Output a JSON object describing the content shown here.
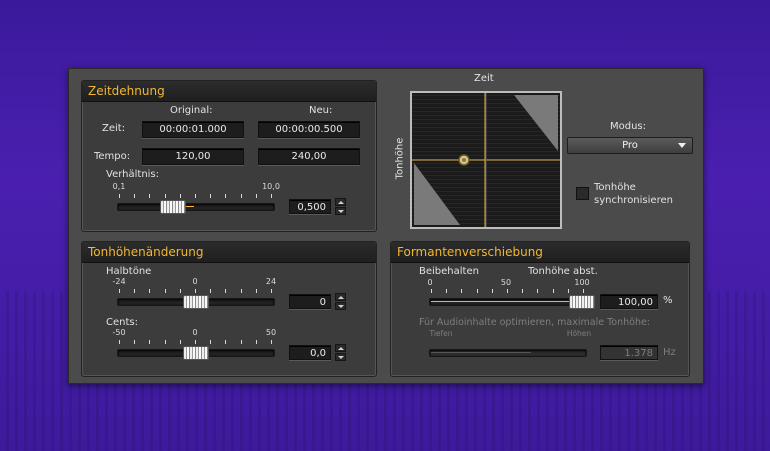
{
  "zeitdehnung": {
    "title": "Zeitdehnung",
    "col_original": "Original:",
    "col_neu": "Neu:",
    "zeit_label": "Zeit:",
    "zeit_original": "00:00:01.000",
    "zeit_neu": "00:00:00.500",
    "tempo_label": "Tempo:",
    "tempo_original": "120,00",
    "tempo_neu": "240,00",
    "ratio_label": "Verhältnis:",
    "ratio_min": "0,1",
    "ratio_max": "10,0",
    "ratio_value": "0,500"
  },
  "tonhoehe": {
    "title": "Tonhöhenänderung",
    "halbtoene_label": "Halbtöne",
    "halbtoene_min": "-24",
    "halbtoene_mid": "0",
    "halbtoene_max": "24",
    "halbtoene_value": "0",
    "cents_label": "Cents:",
    "cents_min": "-50",
    "cents_mid": "0",
    "cents_max": "50",
    "cents_value": "0,0"
  },
  "graph": {
    "x_label": "Zeit",
    "y_label": "Tonhöhe"
  },
  "modus": {
    "label": "Modus:",
    "selected": "Pro"
  },
  "sync": {
    "label_line1": "Tonhöhe",
    "label_line2": "synchronisieren",
    "checked": false
  },
  "formant": {
    "title": "Formantenverschiebung",
    "beibehalten": "Beibehalten",
    "tonhoehe_abst": "Tonhöhe abst.",
    "scale_0": "0",
    "scale_50": "50",
    "scale_100": "100",
    "value": "100,00",
    "unit": "%",
    "optimize_label": "Für Audioinhalte optimieren, maximale Tonhöhe:",
    "tiefen": "Tiefen",
    "hoehen": "Höhen",
    "hz_value": "1.378",
    "hz_unit": "Hz"
  },
  "colors": {
    "accent": "#f2b731",
    "background": "#4a1fb0"
  }
}
